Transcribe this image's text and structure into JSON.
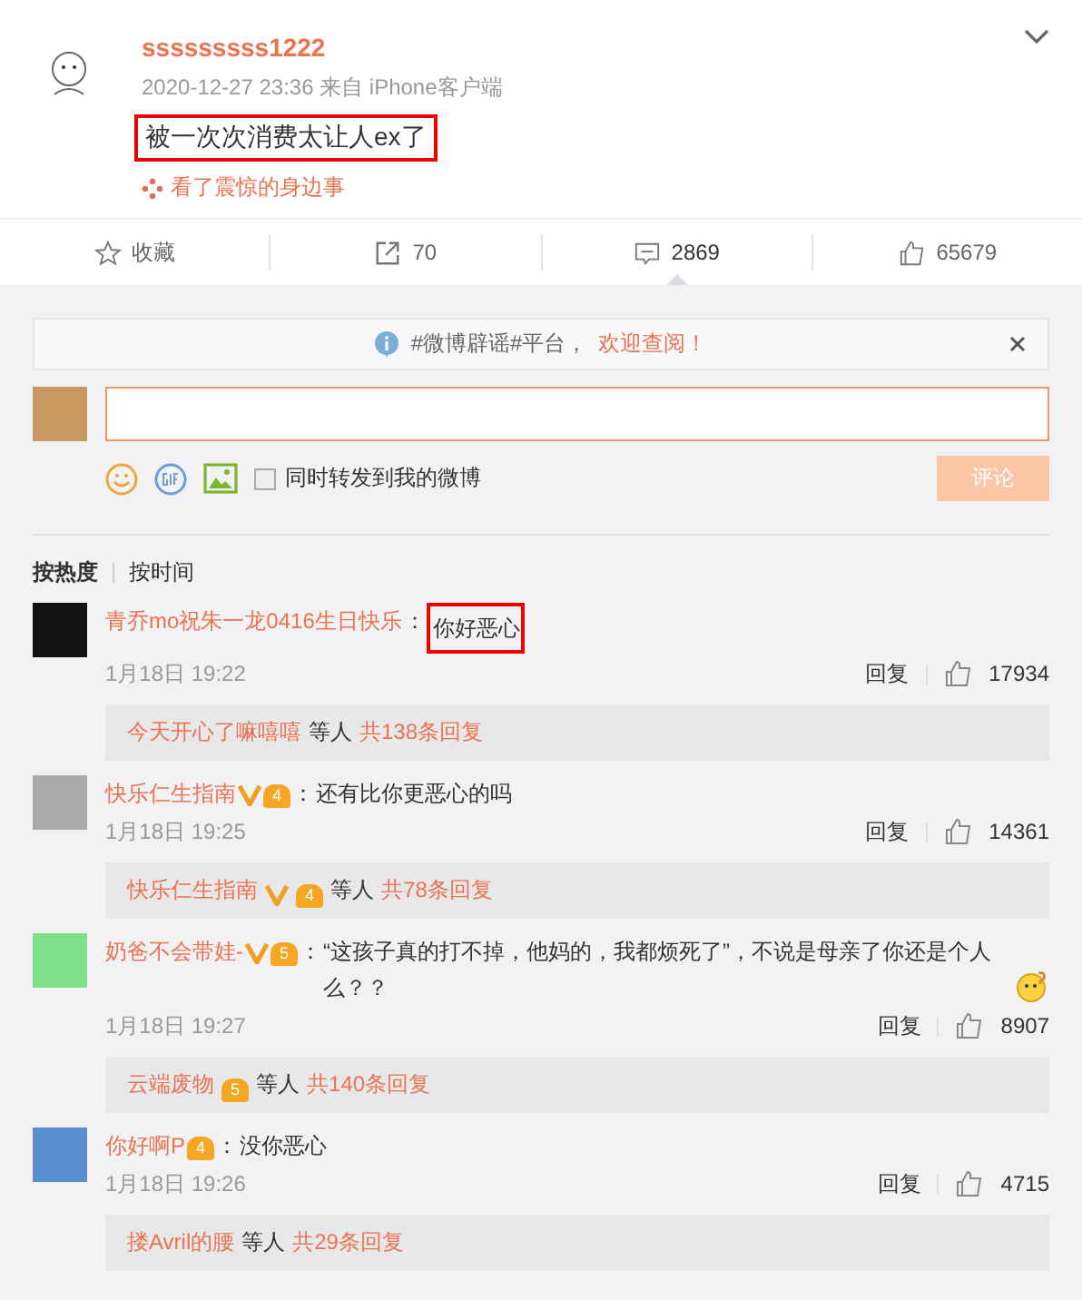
{
  "post": {
    "author": "sssssssss1222",
    "meta": "2020-12-27 23:36 来自 iPhone客户端",
    "text": "被一次次消费太让人ex了",
    "highlighted": true,
    "link": "看了震惊的身边事"
  },
  "actions": [
    {
      "kind": "star",
      "label": "收藏",
      "selected": false
    },
    {
      "kind": "share",
      "label": "70",
      "selected": false
    },
    {
      "kind": "comment",
      "label": "2869",
      "selected": true
    },
    {
      "kind": "like",
      "label": "65679",
      "selected": false
    }
  ],
  "notice": {
    "text": "#微博辟谣#平台，",
    "link": "欢迎查阅！"
  },
  "composer": {
    "forward_label": "同时转发到我的微博",
    "forward_checked": false,
    "submit": "评论",
    "submit_disabled": true
  },
  "sort_tabs": [
    {
      "label": "按热度",
      "selected": true
    },
    {
      "label": "按时间",
      "selected": false
    }
  ],
  "comments": [
    {
      "name": "青乔mo祝朱一龙0416生日快乐",
      "verified": false,
      "colon": "：",
      "text": "你好恶心",
      "highlighted": true,
      "trailing_emoji": false,
      "time": "1月18日 19:22",
      "reply": "回复",
      "likes": "17934",
      "sub": {
        "name": "今天开心了嘛嘻嘻",
        "verified": false,
        "others": "等人",
        "count": "共138条回复"
      }
    },
    {
      "name": "快乐仁生指南",
      "verified": true,
      "level": "4",
      "colon": "：",
      "text": "还有比你更恶心的吗",
      "highlighted": false,
      "trailing_emoji": false,
      "time": "1月18日 19:25",
      "reply": "回复",
      "likes": "14361",
      "sub": {
        "name": "快乐仁生指南",
        "verified": true,
        "level": "4",
        "others": "等人",
        "count": "共78条回复"
      }
    },
    {
      "name": "奶爸不会带娃-",
      "verified": true,
      "level": "5",
      "colon": "：",
      "text": "“这孩子真的打不掉，他妈的，我都烦死了”，不说是母亲了你还是个人么？？",
      "highlighted": false,
      "trailing_emoji": true,
      "time": "1月18日 19:27",
      "reply": "回复",
      "likes": "8907",
      "sub": {
        "name": "云端废物",
        "verified": false,
        "level": "5",
        "others": "等人",
        "count": "共140条回复"
      }
    },
    {
      "name": "你好啊P",
      "verified": false,
      "level": "4",
      "colon": "：",
      "text": "没你恶心",
      "highlighted": false,
      "trailing_emoji": false,
      "time": "1月18日 19:26",
      "reply": "回复",
      "likes": "4715",
      "sub": {
        "name": "搂Avril的腰",
        "verified": false,
        "others": "等人",
        "count": "共29条回复"
      }
    }
  ]
}
